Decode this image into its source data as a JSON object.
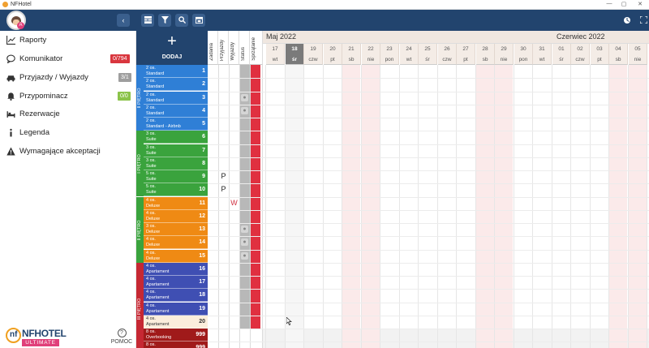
{
  "window": {
    "title": "NFHotel",
    "controls": [
      "—",
      "▢",
      "✕"
    ]
  },
  "toolbar": {
    "avatar_badge": "A",
    "collapse": "‹",
    "buttons": [
      "rooms-icon",
      "filter-icon",
      "search-icon",
      "calendar-icon"
    ],
    "right": [
      "refresh-icon",
      "fullscreen-icon"
    ]
  },
  "menu": [
    {
      "label": "Raporty",
      "icon": "chart-icon"
    },
    {
      "label": "Komunikator",
      "icon": "chat-icon",
      "badge": "0/794",
      "badge_color": "#d9363e"
    },
    {
      "label": "Przyjazdy / Wyjazdy",
      "icon": "car-icon",
      "badge": "3/1",
      "badge_color": "#9e9e9e"
    },
    {
      "label": "Przypominacz",
      "icon": "bell-icon",
      "badge": "0/0",
      "badge_color": "#8bc34a"
    },
    {
      "label": "Rezerwacje",
      "icon": "bed-icon"
    },
    {
      "label": "Legenda",
      "icon": "info-icon"
    },
    {
      "label": "Wymagające akceptacji",
      "icon": "warning-icon"
    }
  ],
  "brand": {
    "name": "NFHOTEL",
    "sub": "ULTIMATE",
    "mark": "nf"
  },
  "help_label": "POMOC",
  "add": {
    "plus": "+",
    "label": "DODAJ"
  },
  "columns": [
    "Zadania",
    "Przyjazdy",
    "Wyjazdy",
    "Status",
    "Sprzątanie"
  ],
  "months": [
    "Maj 2022",
    "Czerwiec 2022"
  ],
  "days": [
    {
      "num": "17",
      "dow": "wt"
    },
    {
      "num": "18",
      "dow": "śr",
      "today": true
    },
    {
      "num": "19",
      "dow": "czw"
    },
    {
      "num": "20",
      "dow": "pt"
    },
    {
      "num": "21",
      "dow": "sb"
    },
    {
      "num": "22",
      "dow": "nie"
    },
    {
      "num": "23",
      "dow": "pon"
    },
    {
      "num": "24",
      "dow": "wt"
    },
    {
      "num": "25",
      "dow": "śr"
    },
    {
      "num": "26",
      "dow": "czw"
    },
    {
      "num": "27",
      "dow": "pt"
    },
    {
      "num": "28",
      "dow": "sb"
    },
    {
      "num": "29",
      "dow": "nie"
    },
    {
      "num": "30",
      "dow": "pon"
    },
    {
      "num": "31",
      "dow": "wt"
    },
    {
      "num": "01",
      "dow": "śr"
    },
    {
      "num": "02",
      "dow": "czw"
    },
    {
      "num": "03",
      "dow": "pt"
    },
    {
      "num": "04",
      "dow": "sb"
    },
    {
      "num": "05",
      "dow": "nie"
    }
  ],
  "floors": [
    {
      "label": "II PIĘTRO",
      "color": "#2f7fd6"
    },
    {
      "label": "I PIĘTRO",
      "color": "#3aa33d"
    },
    {
      "label": "II PIĘTRO",
      "color": "#3aa33d"
    },
    {
      "label": "III PIĘTRO",
      "color": "#c62833"
    }
  ],
  "rooms": [
    {
      "cap": "2 os.",
      "type": "Standard",
      "num": "1",
      "color": "#2f7fd6"
    },
    {
      "cap": "2 os.",
      "type": "Standard",
      "num": "2",
      "color": "#2f7fd6"
    },
    {
      "cap": "2 os.",
      "type": "Standard",
      "num": "3",
      "color": "#2f7fd6",
      "person": true
    },
    {
      "cap": "2 os.",
      "type": "Standard",
      "num": "4",
      "color": "#2f7fd6",
      "person": true
    },
    {
      "cap": "2 os.",
      "type": "Standard - Airbnb",
      "num": "5",
      "color": "#2f7fd6"
    },
    {
      "cap": "3 os.",
      "type": "Suite",
      "num": "6",
      "color": "#3aa33d"
    },
    {
      "cap": "3 os.",
      "type": "Suite",
      "num": "7",
      "color": "#3aa33d"
    },
    {
      "cap": "3 os.",
      "type": "Suite",
      "num": "8",
      "color": "#3aa33d"
    },
    {
      "cap": "5 os.",
      "type": "Suite",
      "num": "9",
      "color": "#3aa33d",
      "arrival": "P"
    },
    {
      "cap": "5 os.",
      "type": "Suite",
      "num": "10",
      "color": "#3aa33d",
      "arrival": "P"
    },
    {
      "cap": "4 os.",
      "type": "Deluxe",
      "num": "11",
      "color": "#ef8a14",
      "departure": "W"
    },
    {
      "cap": "4 os.",
      "type": "Deluxe",
      "num": "12",
      "color": "#ef8a14"
    },
    {
      "cap": "3 os.",
      "type": "Deluxe",
      "num": "13",
      "color": "#ef8a14",
      "person": true
    },
    {
      "cap": "4 os.",
      "type": "Deluxe",
      "num": "14",
      "color": "#ef8a14",
      "person": true
    },
    {
      "cap": "4 os.",
      "type": "Deluxe",
      "num": "15",
      "color": "#ef8a14",
      "person": true
    },
    {
      "cap": "4 os.",
      "type": "Apartament",
      "num": "16",
      "color": "#3f4fb3"
    },
    {
      "cap": "4 os.",
      "type": "Apartament",
      "num": "17",
      "color": "#3f4fb3"
    },
    {
      "cap": "4 os.",
      "type": "Apartament",
      "num": "18",
      "color": "#3f4fb3"
    },
    {
      "cap": "4 os.",
      "type": "Apartament",
      "num": "19",
      "color": "#3f4fb3"
    },
    {
      "cap": "4 os.",
      "type": "Apartament",
      "num": "20",
      "color": "#fbeedc",
      "dark": true
    },
    {
      "cap": "8 os.",
      "type": "Overbooking",
      "num": "999",
      "color": "#a01a1a"
    },
    {
      "cap": "8 os.",
      "type": "",
      "num": "999",
      "color": "#a01a1a"
    }
  ]
}
